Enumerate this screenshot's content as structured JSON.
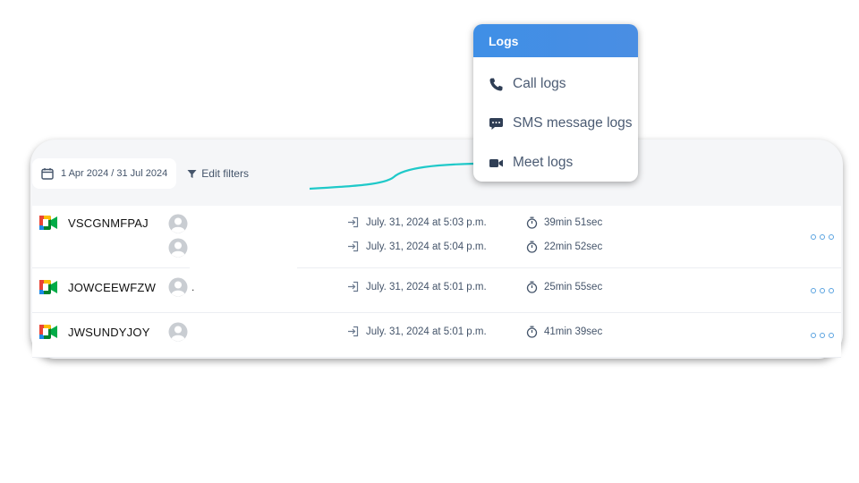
{
  "filters": {
    "date_range": "1 Apr 2024 / 31 Jul 2024",
    "edit_filters": "Edit filters"
  },
  "meetings": [
    {
      "name": "VSCGNMFPAJ",
      "participants": [
        {
          "joined": "July. 31, 2024 at 5:03 p.m.",
          "duration": "39min 51sec"
        },
        {
          "joined": "July. 31, 2024 at 5:04 p.m.",
          "duration": "22min 52sec"
        }
      ]
    },
    {
      "name": "JOWCEEWFZW",
      "participant_suffix": ".",
      "participants": [
        {
          "joined": "July. 31, 2024 at 5:01 p.m.",
          "duration": "25min 55sec"
        }
      ]
    },
    {
      "name": "JWSUNDYJOY",
      "participants": [
        {
          "joined": "July. 31, 2024 at 5:01 p.m.",
          "duration": "41min 39sec"
        }
      ]
    }
  ],
  "logs_menu": {
    "title": "Logs",
    "items": [
      {
        "label": "Call logs",
        "icon": "phone-icon"
      },
      {
        "label": "SMS message logs",
        "icon": "chat-icon"
      },
      {
        "label": "Meet logs",
        "icon": "video-icon"
      }
    ]
  },
  "colors": {
    "accent": "#4a8ee3",
    "arrow": "#1fc9c9",
    "card_bg": "#f5f6f8",
    "muted_text": "#44546a"
  }
}
